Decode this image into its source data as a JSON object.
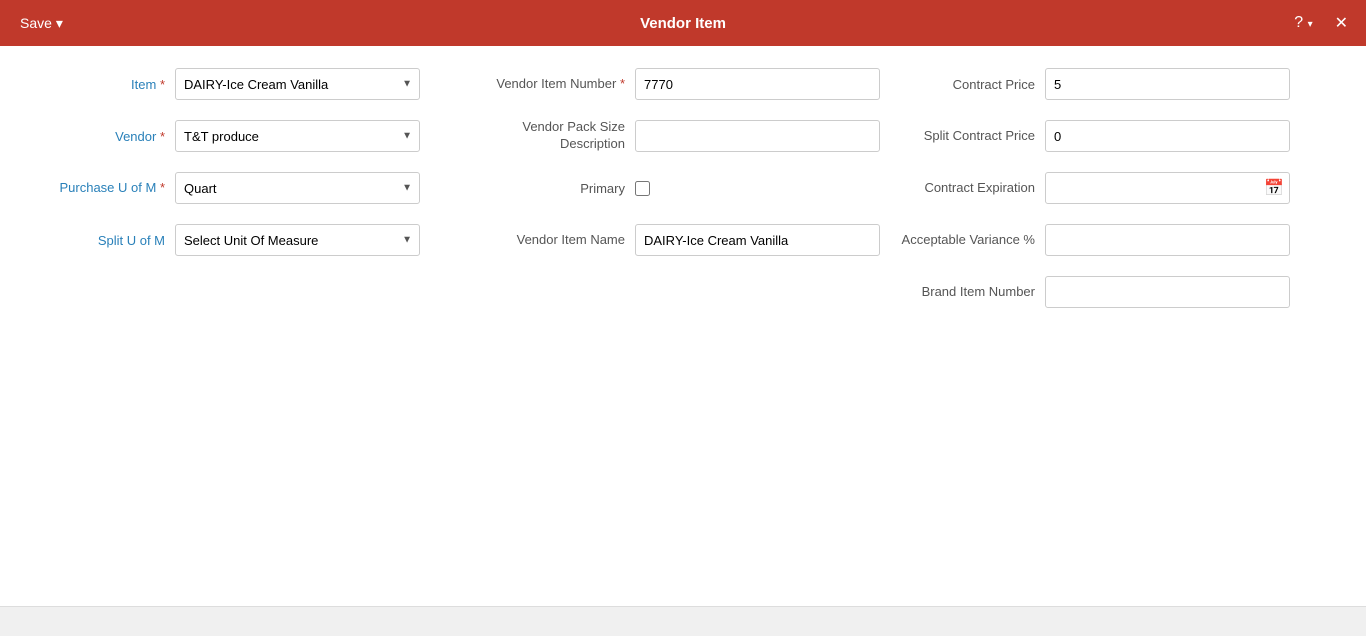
{
  "header": {
    "title": "Vendor Item",
    "save_label": "Save",
    "save_dropdown_icon": "▾",
    "help_icon": "?",
    "close_icon": "✕"
  },
  "left_section": {
    "item_label": "Item",
    "item_required": "*",
    "item_value": "DAIRY-Ice Cream Vanilla",
    "vendor_label": "Vendor",
    "vendor_required": "*",
    "vendor_value": "T&T produce",
    "purchase_uom_label": "Purchase U of M",
    "purchase_uom_required": "*",
    "purchase_uom_value": "Quart",
    "split_uom_label": "Split U of M",
    "split_uom_placeholder": "Select Unit Of Measure"
  },
  "middle_section": {
    "vendor_item_number_label": "Vendor Item Number",
    "vendor_item_number_required": "*",
    "vendor_item_number_value": "7770",
    "vendor_pack_size_label": "Vendor Pack Size Description",
    "vendor_pack_size_value": "",
    "primary_label": "Primary",
    "primary_checked": false,
    "vendor_item_name_label": "Vendor Item Name",
    "vendor_item_name_value": "DAIRY-Ice Cream Vanilla"
  },
  "right_section": {
    "contract_price_label": "Contract Price",
    "contract_price_value": "5",
    "split_contract_price_label": "Split Contract Price",
    "split_contract_price_value": "0",
    "contract_expiration_label": "Contract Expiration",
    "contract_expiration_value": "",
    "acceptable_variance_label": "Acceptable Variance %",
    "acceptable_variance_value": "",
    "brand_item_number_label": "Brand Item Number",
    "brand_item_number_value": ""
  }
}
